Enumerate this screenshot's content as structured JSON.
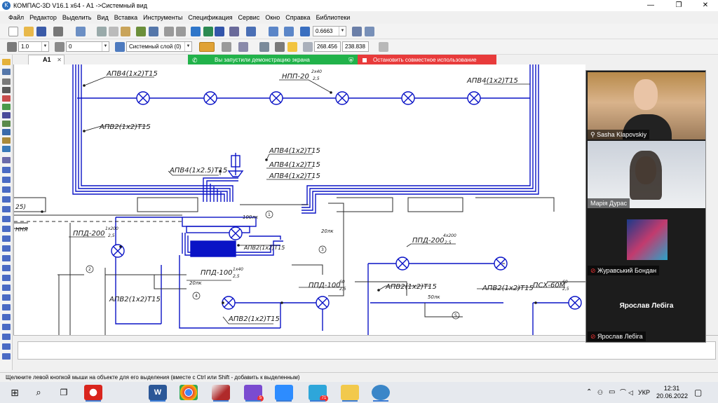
{
  "window": {
    "title": "КОМПАС-3D V16.1 x64 - А1 ->Системный вид",
    "app_icon": "kompas-logo-icon",
    "controls": {
      "minimize": "—",
      "maximize": "❐",
      "close": "✕"
    }
  },
  "menu": [
    "Файл",
    "Редактор",
    "Выделить",
    "Вид",
    "Вставка",
    "Инструменты",
    "Спецификация",
    "Сервис",
    "Окно",
    "Справка",
    "Библиотеки"
  ],
  "toolbar1": {
    "zoom_value": "0.6663"
  },
  "toolbar2": {
    "line_weight": "1.0",
    "angle": "0",
    "layer": "Системный слой (0)",
    "coord_x": "268.456",
    "coord_y": "238.838"
  },
  "tab": {
    "label": "А1",
    "close": "✕"
  },
  "share": {
    "running_text": "Вы запустили демонстрацию экрана",
    "stop_text": "Остановить совместное использование"
  },
  "drawing": {
    "labels": {
      "l1": "АПВ4(1х2)Т15",
      "l2": "НПП-20",
      "l2s": "2х40",
      "l2d": "2,5",
      "l3": "АПВ4(1х2)Т15",
      "l4": "АПВ2(1х2)Т15",
      "l5": "АПВ4(1х2.5)Т15",
      "l6": "АПВ4(1х2)Т15",
      "l7": "АПВ4(1х2)Т15",
      "l8": "АПВ4(1х2)Т15",
      "l9": "ППД-200",
      "l9s": "1х200",
      "l9d": "2,5",
      "l10": "АПВ2(1х2)Т15",
      "l11": "ППД-100",
      "l11s": "1х40",
      "l11d": "2,5",
      "l12": "ППД-100",
      "l12s": "60",
      "l12d": "2,5",
      "l13": "АПВ2(1х2)Т15",
      "l14": "АПВ2(1х2)Т15",
      "l15": "ППД-200",
      "l15s": "4х200",
      "l15d": "2,5",
      "l16": "АПВ2(1х2)Т15",
      "l17": "ПСХ-60М",
      "l17s": "60",
      "l17d": "2,5",
      "l18": "АПВ2(1х2)Т15",
      "small1": "20лк",
      "small2": "20лк",
      "small3": "50лк",
      "small4": "100лк",
      "num1": "1",
      "num2": "2",
      "num3": "3",
      "num4": "4",
      "num5": "5",
      "edge1": "25)",
      "edge2": "ННЯ"
    }
  },
  "statusbar": {
    "hint": "Щелкните левой кнопкой мыши на объекте для его выделения (вместе с Ctrl или Shift - добавить к выделенным)"
  },
  "video": {
    "participants": [
      {
        "name": "Sasha Klapovskiy",
        "muted": false
      },
      {
        "name": "Марія Дурас",
        "muted": false
      },
      {
        "name": "Журавський Бондан",
        "muted": true
      },
      {
        "name": "Ярослав Лебіга",
        "muted": true
      }
    ],
    "big_name": "Ярослав Лебіга"
  },
  "taskbar": {
    "tray_lang": "УКР",
    "time": "12:31",
    "date": "20.06.2022",
    "viber_badge": "5",
    "telegram_badge": "71"
  },
  "colors": {
    "drawing_line": "#0a13c6",
    "wall": "#2b2b2b",
    "accent": "#2a6ebd",
    "share_green": "#21b24a",
    "share_red": "#e83b3b"
  }
}
